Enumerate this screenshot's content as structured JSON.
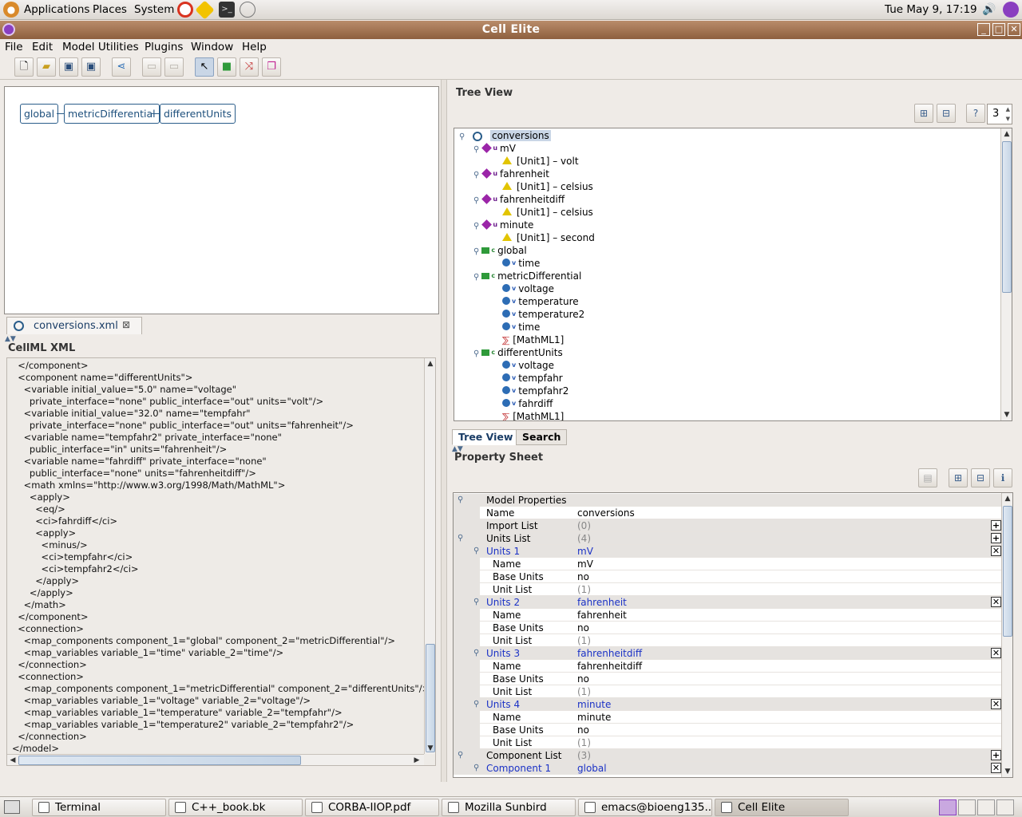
{
  "panel": {
    "menus": [
      "Applications",
      "Places",
      "System"
    ],
    "clock": "Tue May  9, 17:19"
  },
  "window": {
    "title": "Cell Elite"
  },
  "menubar": [
    "File",
    "Edit",
    "Model Utilities",
    "Plugins",
    "Window",
    "Help"
  ],
  "toolbar": {
    "icons": [
      "new-icon",
      "open-icon",
      "save-icon",
      "save-all-icon",
      "connect-icon",
      "copy-icon",
      "paste-icon",
      "select-icon",
      "component-icon",
      "connection-icon",
      "group-icon"
    ]
  },
  "diagram": {
    "nodes": [
      "global",
      "metricDifferential",
      "differentUnits"
    ]
  },
  "editor": {
    "tab_label": "conversions.xml",
    "section_title": "CellML XML",
    "xml_lines": [
      "  </component>",
      "  <component name=\"differentUnits\">",
      "    <variable initial_value=\"5.0\" name=\"voltage\"",
      "      private_interface=\"none\" public_interface=\"out\" units=\"volt\"/>",
      "    <variable initial_value=\"32.0\" name=\"tempfahr\"",
      "      private_interface=\"none\" public_interface=\"out\" units=\"fahrenheit\"/>",
      "    <variable name=\"tempfahr2\" private_interface=\"none\"",
      "      public_interface=\"in\" units=\"fahrenheit\"/>",
      "    <variable name=\"fahrdiff\" private_interface=\"none\"",
      "      public_interface=\"none\" units=\"fahrenheitdiff\"/>",
      "    <math xmlns=\"http://www.w3.org/1998/Math/MathML\">",
      "      <apply>",
      "        <eq/>",
      "        <ci>fahrdiff</ci>",
      "        <apply>",
      "          <minus/>",
      "          <ci>tempfahr</ci>",
      "          <ci>tempfahr2</ci>",
      "        </apply>",
      "      </apply>",
      "    </math>",
      "  </component>",
      "  <connection>",
      "    <map_components component_1=\"global\" component_2=\"metricDifferential\"/>",
      "    <map_variables variable_1=\"time\" variable_2=\"time\"/>",
      "  </connection>",
      "  <connection>",
      "    <map_components component_1=\"metricDifferential\" component_2=\"differentUnits\"/>",
      "    <map_variables variable_1=\"voltage\" variable_2=\"voltage\"/>",
      "    <map_variables variable_1=\"temperature\" variable_2=\"tempfahr\"/>",
      "    <map_variables variable_1=\"temperature2\" variable_2=\"tempfahr2\"/>",
      "  </connection>",
      "</model>"
    ]
  },
  "tree": {
    "title": "Tree View",
    "depth_value": "3",
    "root": "conversions",
    "rows": [
      {
        "level": 1,
        "kind": "unit",
        "sup": "u",
        "label": "mV"
      },
      {
        "level": 2,
        "kind": "warn",
        "label": "[Unit1] – volt"
      },
      {
        "level": 1,
        "kind": "unit",
        "sup": "u",
        "label": "fahrenheit"
      },
      {
        "level": 2,
        "kind": "warn",
        "label": "[Unit1] – celsius"
      },
      {
        "level": 1,
        "kind": "unit",
        "sup": "u",
        "label": "fahrenheitdiff"
      },
      {
        "level": 2,
        "kind": "warn",
        "label": "[Unit1] – celsius"
      },
      {
        "level": 1,
        "kind": "unit",
        "sup": "u",
        "label": "minute"
      },
      {
        "level": 2,
        "kind": "warn",
        "label": "[Unit1] – second"
      },
      {
        "level": 1,
        "kind": "comp",
        "sup": "c",
        "label": "global"
      },
      {
        "level": 2,
        "kind": "var",
        "sup": "v",
        "label": "time"
      },
      {
        "level": 1,
        "kind": "comp",
        "sup": "c",
        "label": "metricDifferential"
      },
      {
        "level": 2,
        "kind": "var",
        "sup": "v",
        "label": "voltage"
      },
      {
        "level": 2,
        "kind": "var",
        "sup": "v",
        "label": "temperature"
      },
      {
        "level": 2,
        "kind": "var",
        "sup": "v",
        "label": "temperature2"
      },
      {
        "level": 2,
        "kind": "var",
        "sup": "v",
        "label": "time"
      },
      {
        "level": 2,
        "kind": "math",
        "label": "[MathML1]"
      },
      {
        "level": 1,
        "kind": "comp",
        "sup": "c",
        "label": "differentUnits"
      },
      {
        "level": 2,
        "kind": "var",
        "sup": "v",
        "label": "voltage"
      },
      {
        "level": 2,
        "kind": "var",
        "sup": "v",
        "label": "tempfahr"
      },
      {
        "level": 2,
        "kind": "var",
        "sup": "v",
        "label": "tempfahr2"
      },
      {
        "level": 2,
        "kind": "var",
        "sup": "v",
        "label": "fahrdiff"
      },
      {
        "level": 2,
        "kind": "math",
        "label": "[MathML1]"
      }
    ]
  },
  "tabs": [
    "Tree View",
    "Search"
  ],
  "properties": {
    "title": "Property Sheet",
    "rows": [
      {
        "type": "hdr",
        "key": "Model Properties",
        "value": "",
        "indent": 0,
        "btn": ""
      },
      {
        "type": "row",
        "key": "Name",
        "value": "conversions",
        "indent": 0,
        "btn": ""
      },
      {
        "type": "hdr",
        "key": "Import List",
        "value": "(0)",
        "indent": 0,
        "btn": "+",
        "gray": true
      },
      {
        "type": "hdr",
        "key": "Units List",
        "value": "(4)",
        "indent": 0,
        "btn": "+",
        "gray": true
      },
      {
        "type": "hdr",
        "key": "Units 1",
        "value": "mV",
        "indent": 0,
        "btn": "✕",
        "blue": true
      },
      {
        "type": "row",
        "key": "Name",
        "value": "mV",
        "indent": 1,
        "btn": ""
      },
      {
        "type": "row",
        "key": "Base Units",
        "value": "no",
        "indent": 1,
        "btn": ""
      },
      {
        "type": "row",
        "key": "Unit List",
        "value": "(1)",
        "indent": 1,
        "btn": "",
        "gray": true
      },
      {
        "type": "hdr",
        "key": "Units 2",
        "value": "fahrenheit",
        "indent": 0,
        "btn": "✕",
        "blue": true
      },
      {
        "type": "row",
        "key": "Name",
        "value": "fahrenheit",
        "indent": 1,
        "btn": ""
      },
      {
        "type": "row",
        "key": "Base Units",
        "value": "no",
        "indent": 1,
        "btn": ""
      },
      {
        "type": "row",
        "key": "Unit List",
        "value": "(1)",
        "indent": 1,
        "btn": "",
        "gray": true
      },
      {
        "type": "hdr",
        "key": "Units 3",
        "value": "fahrenheitdiff",
        "indent": 0,
        "btn": "✕",
        "blue": true
      },
      {
        "type": "row",
        "key": "Name",
        "value": "fahrenheitdiff",
        "indent": 1,
        "btn": ""
      },
      {
        "type": "row",
        "key": "Base Units",
        "value": "no",
        "indent": 1,
        "btn": ""
      },
      {
        "type": "row",
        "key": "Unit List",
        "value": "(1)",
        "indent": 1,
        "btn": "",
        "gray": true
      },
      {
        "type": "hdr",
        "key": "Units 4",
        "value": "minute",
        "indent": 0,
        "btn": "✕",
        "blue": true
      },
      {
        "type": "row",
        "key": "Name",
        "value": "minute",
        "indent": 1,
        "btn": ""
      },
      {
        "type": "row",
        "key": "Base Units",
        "value": "no",
        "indent": 1,
        "btn": ""
      },
      {
        "type": "row",
        "key": "Unit List",
        "value": "(1)",
        "indent": 1,
        "btn": "",
        "gray": true
      },
      {
        "type": "hdr",
        "key": "Component List",
        "value": "(3)",
        "indent": 0,
        "btn": "+",
        "gray": true
      },
      {
        "type": "hdr",
        "key": "Component 1",
        "value": "global",
        "indent": 0,
        "btn": "✕",
        "blue": true
      }
    ]
  },
  "taskbar": {
    "tasks": [
      {
        "label": "Terminal",
        "active": false
      },
      {
        "label": "C++_book.bk",
        "active": false
      },
      {
        "label": "CORBA-IIOP.pdf",
        "active": false
      },
      {
        "label": "Mozilla Sunbird",
        "active": false
      },
      {
        "label": "emacs@bioeng135...",
        "active": false
      },
      {
        "label": "Cell Elite",
        "active": true
      }
    ]
  },
  "colors": {
    "titlebar": "#9a6a48",
    "selection": "#c9d6e6",
    "link_blue": "#1b32c6"
  }
}
